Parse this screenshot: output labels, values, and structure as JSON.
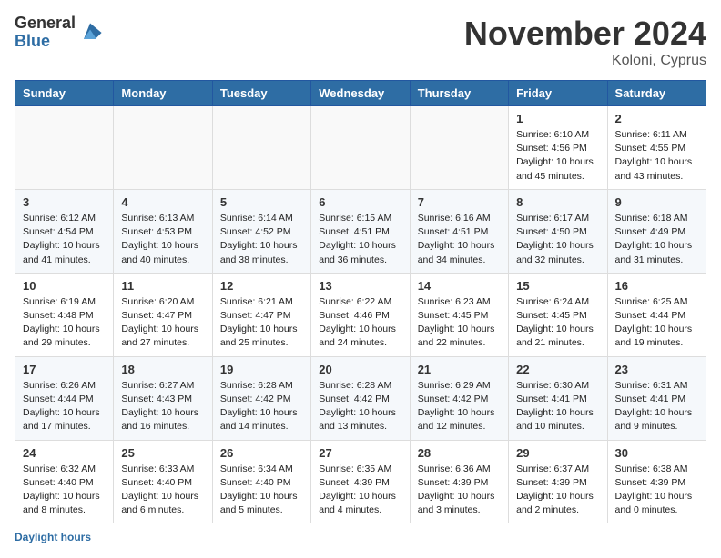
{
  "header": {
    "logo_general": "General",
    "logo_blue": "Blue",
    "month_title": "November 2024",
    "location": "Koloni, Cyprus"
  },
  "days_of_week": [
    "Sunday",
    "Monday",
    "Tuesday",
    "Wednesday",
    "Thursday",
    "Friday",
    "Saturday"
  ],
  "footer": {
    "label": "Daylight hours"
  },
  "weeks": [
    [
      {
        "day": "",
        "info": ""
      },
      {
        "day": "",
        "info": ""
      },
      {
        "day": "",
        "info": ""
      },
      {
        "day": "",
        "info": ""
      },
      {
        "day": "",
        "info": ""
      },
      {
        "day": "1",
        "info": "Sunrise: 6:10 AM\nSunset: 4:56 PM\nDaylight: 10 hours and 45 minutes."
      },
      {
        "day": "2",
        "info": "Sunrise: 6:11 AM\nSunset: 4:55 PM\nDaylight: 10 hours and 43 minutes."
      }
    ],
    [
      {
        "day": "3",
        "info": "Sunrise: 6:12 AM\nSunset: 4:54 PM\nDaylight: 10 hours and 41 minutes."
      },
      {
        "day": "4",
        "info": "Sunrise: 6:13 AM\nSunset: 4:53 PM\nDaylight: 10 hours and 40 minutes."
      },
      {
        "day": "5",
        "info": "Sunrise: 6:14 AM\nSunset: 4:52 PM\nDaylight: 10 hours and 38 minutes."
      },
      {
        "day": "6",
        "info": "Sunrise: 6:15 AM\nSunset: 4:51 PM\nDaylight: 10 hours and 36 minutes."
      },
      {
        "day": "7",
        "info": "Sunrise: 6:16 AM\nSunset: 4:51 PM\nDaylight: 10 hours and 34 minutes."
      },
      {
        "day": "8",
        "info": "Sunrise: 6:17 AM\nSunset: 4:50 PM\nDaylight: 10 hours and 32 minutes."
      },
      {
        "day": "9",
        "info": "Sunrise: 6:18 AM\nSunset: 4:49 PM\nDaylight: 10 hours and 31 minutes."
      }
    ],
    [
      {
        "day": "10",
        "info": "Sunrise: 6:19 AM\nSunset: 4:48 PM\nDaylight: 10 hours and 29 minutes."
      },
      {
        "day": "11",
        "info": "Sunrise: 6:20 AM\nSunset: 4:47 PM\nDaylight: 10 hours and 27 minutes."
      },
      {
        "day": "12",
        "info": "Sunrise: 6:21 AM\nSunset: 4:47 PM\nDaylight: 10 hours and 25 minutes."
      },
      {
        "day": "13",
        "info": "Sunrise: 6:22 AM\nSunset: 4:46 PM\nDaylight: 10 hours and 24 minutes."
      },
      {
        "day": "14",
        "info": "Sunrise: 6:23 AM\nSunset: 4:45 PM\nDaylight: 10 hours and 22 minutes."
      },
      {
        "day": "15",
        "info": "Sunrise: 6:24 AM\nSunset: 4:45 PM\nDaylight: 10 hours and 21 minutes."
      },
      {
        "day": "16",
        "info": "Sunrise: 6:25 AM\nSunset: 4:44 PM\nDaylight: 10 hours and 19 minutes."
      }
    ],
    [
      {
        "day": "17",
        "info": "Sunrise: 6:26 AM\nSunset: 4:44 PM\nDaylight: 10 hours and 17 minutes."
      },
      {
        "day": "18",
        "info": "Sunrise: 6:27 AM\nSunset: 4:43 PM\nDaylight: 10 hours and 16 minutes."
      },
      {
        "day": "19",
        "info": "Sunrise: 6:28 AM\nSunset: 4:42 PM\nDaylight: 10 hours and 14 minutes."
      },
      {
        "day": "20",
        "info": "Sunrise: 6:28 AM\nSunset: 4:42 PM\nDaylight: 10 hours and 13 minutes."
      },
      {
        "day": "21",
        "info": "Sunrise: 6:29 AM\nSunset: 4:42 PM\nDaylight: 10 hours and 12 minutes."
      },
      {
        "day": "22",
        "info": "Sunrise: 6:30 AM\nSunset: 4:41 PM\nDaylight: 10 hours and 10 minutes."
      },
      {
        "day": "23",
        "info": "Sunrise: 6:31 AM\nSunset: 4:41 PM\nDaylight: 10 hours and 9 minutes."
      }
    ],
    [
      {
        "day": "24",
        "info": "Sunrise: 6:32 AM\nSunset: 4:40 PM\nDaylight: 10 hours and 8 minutes."
      },
      {
        "day": "25",
        "info": "Sunrise: 6:33 AM\nSunset: 4:40 PM\nDaylight: 10 hours and 6 minutes."
      },
      {
        "day": "26",
        "info": "Sunrise: 6:34 AM\nSunset: 4:40 PM\nDaylight: 10 hours and 5 minutes."
      },
      {
        "day": "27",
        "info": "Sunrise: 6:35 AM\nSunset: 4:39 PM\nDaylight: 10 hours and 4 minutes."
      },
      {
        "day": "28",
        "info": "Sunrise: 6:36 AM\nSunset: 4:39 PM\nDaylight: 10 hours and 3 minutes."
      },
      {
        "day": "29",
        "info": "Sunrise: 6:37 AM\nSunset: 4:39 PM\nDaylight: 10 hours and 2 minutes."
      },
      {
        "day": "30",
        "info": "Sunrise: 6:38 AM\nSunset: 4:39 PM\nDaylight: 10 hours and 0 minutes."
      }
    ]
  ]
}
